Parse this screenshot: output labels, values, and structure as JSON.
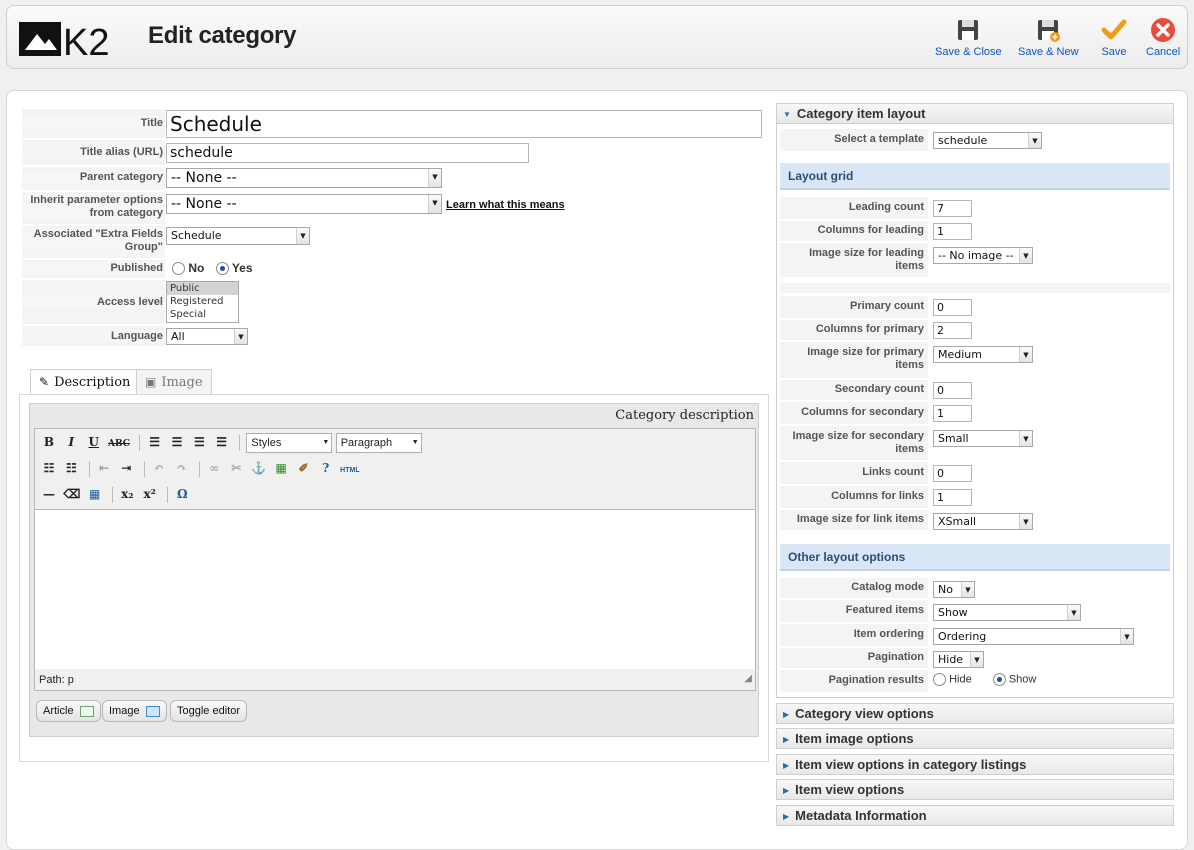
{
  "header": {
    "title": "Edit category",
    "buttons": [
      {
        "label": "Save & Close"
      },
      {
        "label": "Save & New"
      },
      {
        "label": "Save"
      },
      {
        "label": "Cancel"
      }
    ]
  },
  "form": {
    "title_label": "Title",
    "title_value": "Schedule",
    "alias_label": "Title alias (URL)",
    "alias_value": "schedule",
    "parent_label": "Parent category",
    "parent_value": "-- None --",
    "inherit_label": "Inherit parameter options from category",
    "inherit_value": "-- None --",
    "learn_link": "Learn what this means",
    "extra_label": "Associated \"Extra Fields Group\"",
    "extra_value": "Schedule",
    "published_label": "Published",
    "published_no": "No",
    "published_yes": "Yes",
    "access_label": "Access level",
    "access_options": [
      "Public",
      "Registered",
      "Special"
    ],
    "language_label": "Language",
    "language_value": "All"
  },
  "tabs": [
    {
      "label": "Description"
    },
    {
      "label": "Image"
    }
  ],
  "editor": {
    "heading": "Category description",
    "styles_value": "Styles",
    "format_value": "Paragraph",
    "html_label": "HTML",
    "path": "Path: p",
    "btn_article": "Article",
    "btn_image": "Image",
    "btn_toggle": "Toggle editor"
  },
  "right": {
    "layout_header": "Category item layout",
    "select_template_label": "Select a template",
    "select_template_value": "schedule",
    "layout_grid": "Layout grid",
    "leading_count_label": "Leading count",
    "leading_count": "7",
    "columns_leading_label": "Columns for leading",
    "columns_leading": "1",
    "imgsize_leading_label": "Image size for leading items",
    "imgsize_leading": "-- No image --",
    "primary_count_label": "Primary count",
    "primary_count": "0",
    "columns_primary_label": "Columns for primary",
    "columns_primary": "2",
    "imgsize_primary_label": "Image size for primary items",
    "imgsize_primary": "Medium",
    "secondary_count_label": "Secondary count",
    "secondary_count": "0",
    "columns_secondary_label": "Columns for secondary",
    "columns_secondary": "1",
    "imgsize_secondary_label": "Image size for secondary items",
    "imgsize_secondary": "Small",
    "links_count_label": "Links count",
    "links_count": "0",
    "columns_links_label": "Columns for links",
    "columns_links": "1",
    "imgsize_links_label": "Image size for link items",
    "imgsize_links": "XSmall",
    "other_options": "Other layout options",
    "catalog_mode_label": "Catalog mode",
    "catalog_mode": "No",
    "featured_label": "Featured items",
    "featured": "Show",
    "ordering_label": "Item ordering",
    "ordering": "Ordering",
    "pagination_label": "Pagination",
    "pagination": "Hide",
    "pag_results_label": "Pagination results",
    "pag_hide": "Hide",
    "pag_show": "Show",
    "collapsed": [
      "Category view options",
      "Item image options",
      "Item view options in category listings",
      "Item view options",
      "Metadata Information"
    ]
  },
  "colors": {
    "accent": "#0b55c4",
    "section_head": "#d9e6f5",
    "save_icon": "#f39c12",
    "cancel_icon": "#e74c3c"
  }
}
